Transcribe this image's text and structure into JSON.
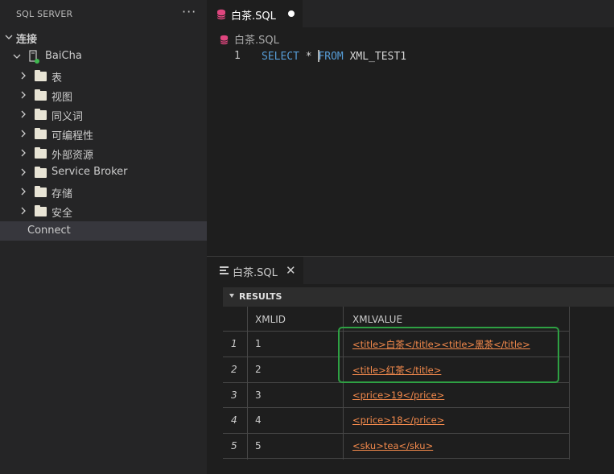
{
  "sidebar": {
    "title": "SQL SERVER",
    "more": "···",
    "section_label": "连接",
    "server_name": "BaiCha",
    "folders": [
      {
        "label": "表"
      },
      {
        "label": "视图"
      },
      {
        "label": "同义词"
      },
      {
        "label": "可编程性"
      },
      {
        "label": "外部资源"
      },
      {
        "label": "Service Broker"
      },
      {
        "label": "存储"
      },
      {
        "label": "安全"
      }
    ],
    "connect_label": "Connect"
  },
  "editor": {
    "tab_label": "白茶.SQL",
    "breadcrumb": "白茶.SQL",
    "line_number": "1",
    "code": {
      "kw1": "SELECT",
      "star": " * ",
      "kw2": "FROM",
      "rest": " XML_TEST1"
    }
  },
  "results_panel": {
    "tab_label": "白茶.SQL",
    "close": "✕",
    "header": "RESULTS",
    "columns": [
      "XMLID",
      "XMLVALUE"
    ],
    "rows": [
      {
        "num": "1",
        "id": "1",
        "value": "<title>白茶</title><title>黑茶</title>"
      },
      {
        "num": "2",
        "id": "2",
        "value": "<title>红茶</title>"
      },
      {
        "num": "3",
        "id": "3",
        "value": "<price>19</price>"
      },
      {
        "num": "4",
        "id": "4",
        "value": "<price>18</price>"
      },
      {
        "num": "5",
        "id": "5",
        "value": "<sku>tea</sku>"
      }
    ]
  },
  "colors": {
    "accent_link": "#f48a4c",
    "highlight_box": "#2ea043",
    "keyword": "#569cd6",
    "db_icon": "#e0467f"
  }
}
